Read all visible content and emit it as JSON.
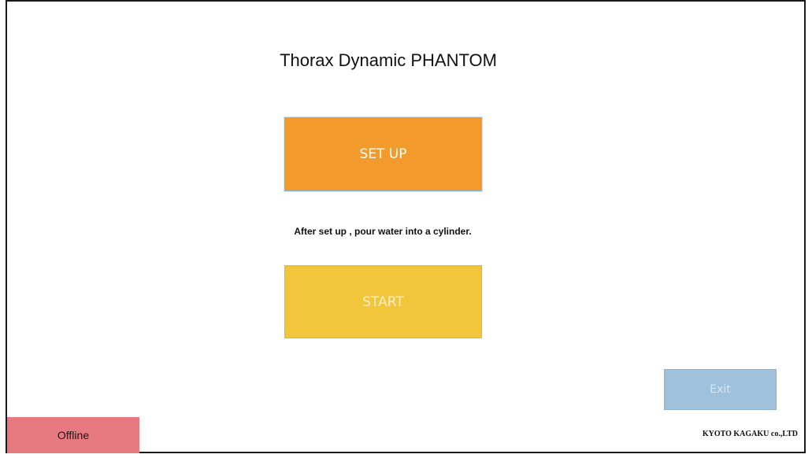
{
  "app": {
    "title": "Thorax Dynamic PHANTOM"
  },
  "buttons": {
    "setup_label": "SET UP",
    "start_label": "START",
    "exit_label": "Exit"
  },
  "instruction": "After set up , pour water into a cylinder.",
  "status": {
    "connection": "Offline"
  },
  "footer": {
    "company": "KYOTO KAGAKU co.,LTD"
  },
  "colors": {
    "setup": "#f39a2d",
    "start": "#f2c63b",
    "exit": "#9fc1dc",
    "offline": "#e77a80"
  }
}
